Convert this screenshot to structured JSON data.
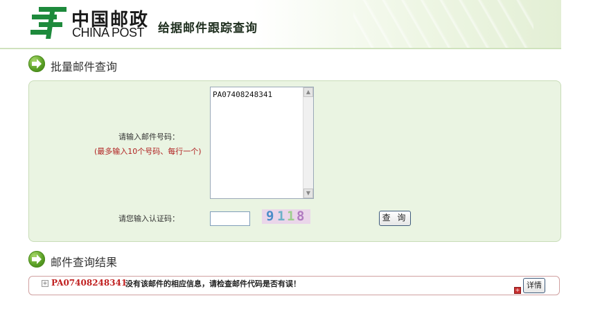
{
  "header": {
    "logo_cn": "中国邮政",
    "logo_en": "CHINA POST",
    "title": "给据邮件跟踪查询",
    "icon": "china-post-logo"
  },
  "batch_section": {
    "title": "批量邮件查询",
    "icon": "green-arrow-icon"
  },
  "query_form": {
    "mail_label": "请输入邮件号码：",
    "mail_hint": "(最多输入10个号码、每行一个)",
    "mail_value": "PA07408248341",
    "captcha_label": "请您输入认证码：",
    "captcha_value": "",
    "captcha_chars": [
      "9",
      "1",
      "1",
      "8"
    ],
    "captcha_colors": [
      "#4a8cc8",
      "#6bb0c8",
      "#9ccf8c",
      "#b07ac0"
    ],
    "query_button": "查 询"
  },
  "result_section": {
    "title": "邮件查询结果",
    "icon": "green-arrow-icon"
  },
  "result": {
    "mail_no": "PA07408248341",
    "message": "没有该邮件的相应信息，请检查邮件代码是否有误！",
    "detail_button": "详情"
  },
  "colors": {
    "accent_green": "#5aa025",
    "panel_bg": "#eaf4e2",
    "error_red": "#c02020"
  }
}
